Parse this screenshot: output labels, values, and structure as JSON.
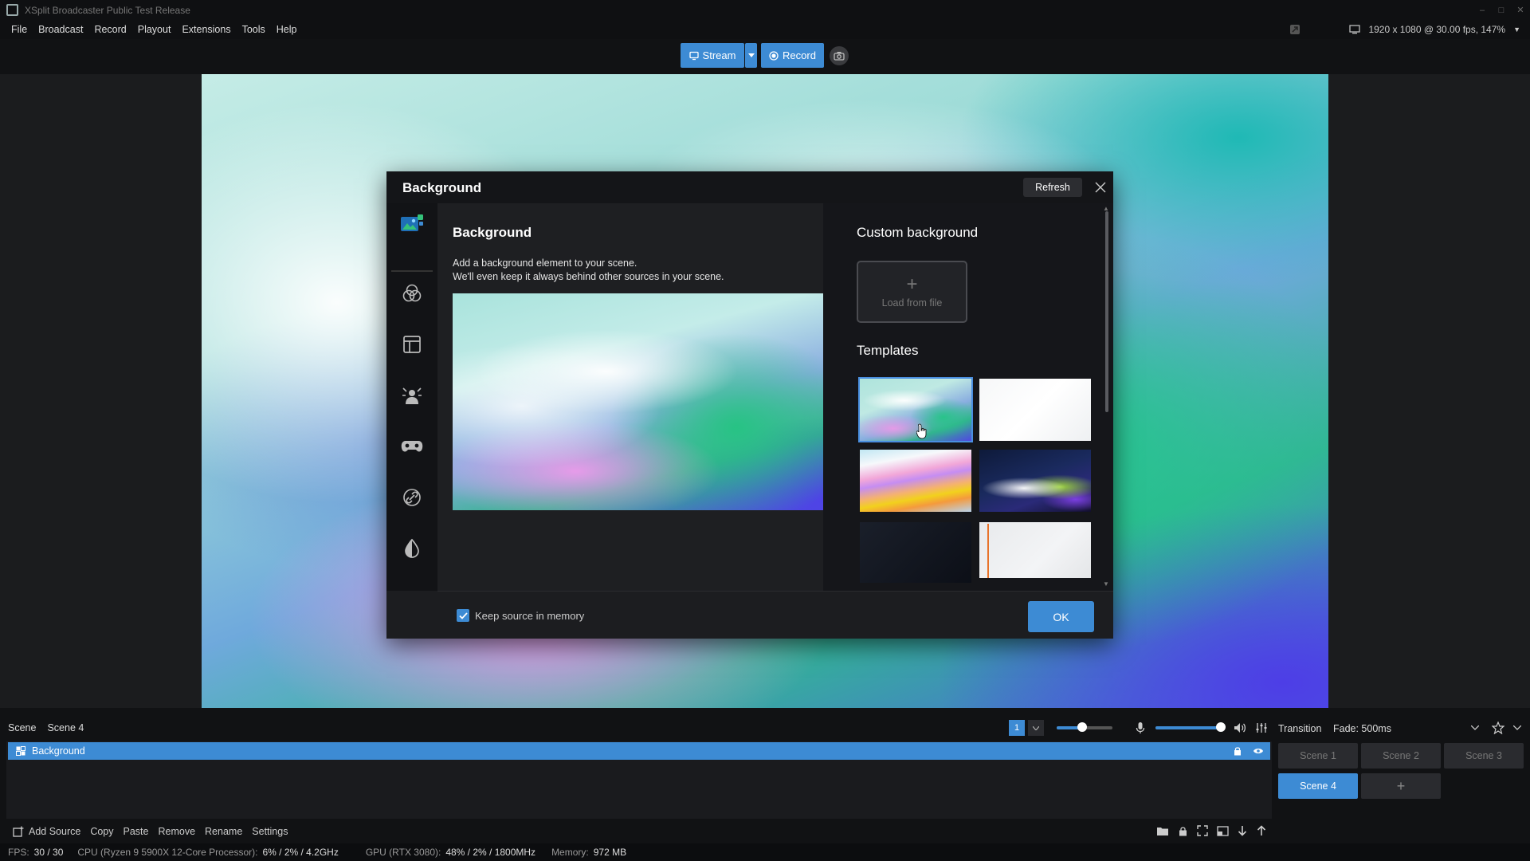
{
  "app": {
    "title": "XSplit Broadcaster Public Test Release"
  },
  "menu": {
    "items": [
      "File",
      "Broadcast",
      "Record",
      "Playout",
      "Extensions",
      "Tools",
      "Help"
    ],
    "resolution": "1920 x 1080 @ 30.00 fps, 147%"
  },
  "toolbar": {
    "stream_label": "Stream",
    "record_label": "Record"
  },
  "dialog": {
    "title": "Background",
    "refresh_label": "Refresh",
    "pane_title": "Background",
    "desc_line1": "Add a background element to your scene.",
    "desc_line2": "We'll even keep it always behind other sources in your scene.",
    "custom_title": "Custom background",
    "load_label": "Load from file",
    "templates_title": "Templates",
    "keep_memory_label": "Keep source in memory",
    "keep_memory_checked": true,
    "ok_label": "OK",
    "side_icons": [
      "background-icon",
      "color-circles-icon",
      "layout-icon",
      "person-effect-icon",
      "gamepad-icon",
      "link-icon",
      "drop-icon"
    ]
  },
  "scene": {
    "label": "Scene",
    "current": "Scene 4",
    "page": "1"
  },
  "transition": {
    "label": "Transition",
    "value": "Fade: 500ms"
  },
  "sources": [
    {
      "name": "Background",
      "selected": true
    }
  ],
  "scene_buttons": [
    "Scene 1",
    "Scene 2",
    "Scene 3",
    "Scene 4"
  ],
  "scene_add": "+",
  "source_toolbar": {
    "add": "Add Source",
    "copy": "Copy",
    "paste": "Paste",
    "remove": "Remove",
    "rename": "Rename",
    "settings": "Settings"
  },
  "status": {
    "fps_label": "FPS:",
    "fps": "30 / 30",
    "cpu_label": "CPU (Ryzen 9 5900X 12-Core Processor):",
    "cpu": "6% / 2% / 4.2GHz",
    "gpu_label": "GPU (RTX 3080):",
    "gpu": "48% / 2% / 1800MHz",
    "mem_label": "Memory:",
    "mem": "972 MB"
  },
  "colors": {
    "accent": "#3d8bd4",
    "panel": "#1c1d20",
    "dark": "#111214"
  },
  "volume": {
    "stream_level": 0.45,
    "mic_level": 0.95
  }
}
